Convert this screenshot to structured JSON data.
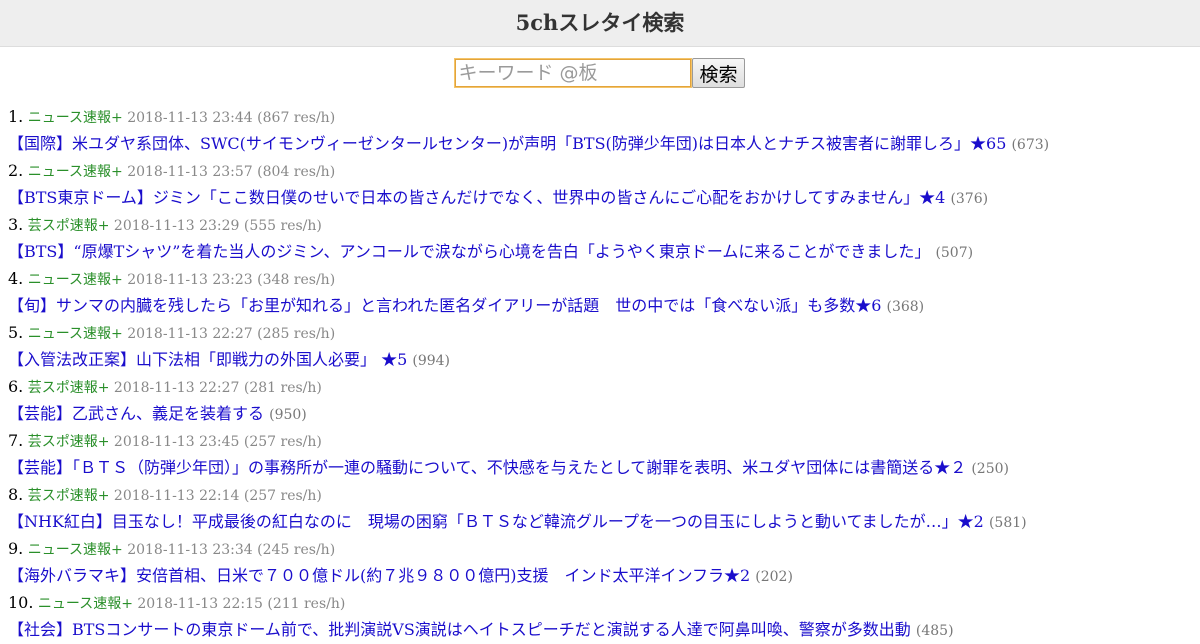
{
  "header": {
    "title": "5chスレタイ検索"
  },
  "search": {
    "placeholder": "キーワード @板",
    "value": "",
    "button_label": "検索"
  },
  "threads": [
    {
      "rank": "1.",
      "board": "ニュース速報+",
      "datetime": "2018-11-13 23:44",
      "speed": "(867 res/h)",
      "title": "【国際】米ユダヤ系団体、SWC(サイモンヴィーゼンタールセンター)が声明「BTS(防弾少年団)は日本人とナチス被害者に謝罪しろ」★65",
      "count": "(673)"
    },
    {
      "rank": "2.",
      "board": "ニュース速報+",
      "datetime": "2018-11-13 23:57",
      "speed": "(804 res/h)",
      "title": "【BTS東京ドーム】ジミン「ここ数日僕のせいで日本の皆さんだけでなく、世界中の皆さんにご心配をおかけしてすみません」★4",
      "count": "(376)"
    },
    {
      "rank": "3.",
      "board": "芸スポ速報+",
      "datetime": "2018-11-13 23:29",
      "speed": "(555 res/h)",
      "title": "【BTS】“原爆Tシャツ”を着た当人のジミン、アンコールで涙ながら心境を告白「ようやく東京ドームに来ることができました」",
      "count": "(507)"
    },
    {
      "rank": "4.",
      "board": "ニュース速報+",
      "datetime": "2018-11-13 23:23",
      "speed": "(348 res/h)",
      "title": "【旬】サンマの内臓を残したら「お里が知れる」と言われた匿名ダイアリーが話題　世の中では「食べない派」も多数★6",
      "count": "(368)"
    },
    {
      "rank": "5.",
      "board": "ニュース速報+",
      "datetime": "2018-11-13 22:27",
      "speed": "(285 res/h)",
      "title": "【入管法改正案】山下法相「即戦力の外国人必要」 ★5",
      "count": "(994)"
    },
    {
      "rank": "6.",
      "board": "芸スポ速報+",
      "datetime": "2018-11-13 22:27",
      "speed": "(281 res/h)",
      "title": "【芸能】乙武さん、義足を装着する",
      "count": "(950)"
    },
    {
      "rank": "7.",
      "board": "芸スポ速報+",
      "datetime": "2018-11-13 23:45",
      "speed": "(257 res/h)",
      "title": "【芸能】「ＢＴＳ（防弾少年団）」の事務所が一連の騒動について、不快感を与えたとして謝罪を表明、米ユダヤ団体には書簡送る★２",
      "count": "(250)"
    },
    {
      "rank": "8.",
      "board": "芸スポ速報+",
      "datetime": "2018-11-13 22:14",
      "speed": "(257 res/h)",
      "title": "【NHK紅白】目玉なし！平成最後の紅白なのに　現場の困窮「ＢＴＳなど韓流グループを一つの目玉にしようと動いてましたが…」★2",
      "count": "(581)"
    },
    {
      "rank": "9.",
      "board": "ニュース速報+",
      "datetime": "2018-11-13 23:34",
      "speed": "(245 res/h)",
      "title": "【海外バラマキ】安倍首相、日米で７００億ドル(約７兆９８００億円)支援　インド太平洋インフラ★2",
      "count": "(202)"
    },
    {
      "rank": "10.",
      "board": "ニュース速報+",
      "datetime": "2018-11-13 22:15",
      "speed": "(211 res/h)",
      "title": "【社会】BTSコンサートの東京ドーム前で、批判演説VS演説はヘイトスピーチだと演説する人達で阿鼻叫喚、警察が多数出動",
      "count": "(485)"
    }
  ]
}
